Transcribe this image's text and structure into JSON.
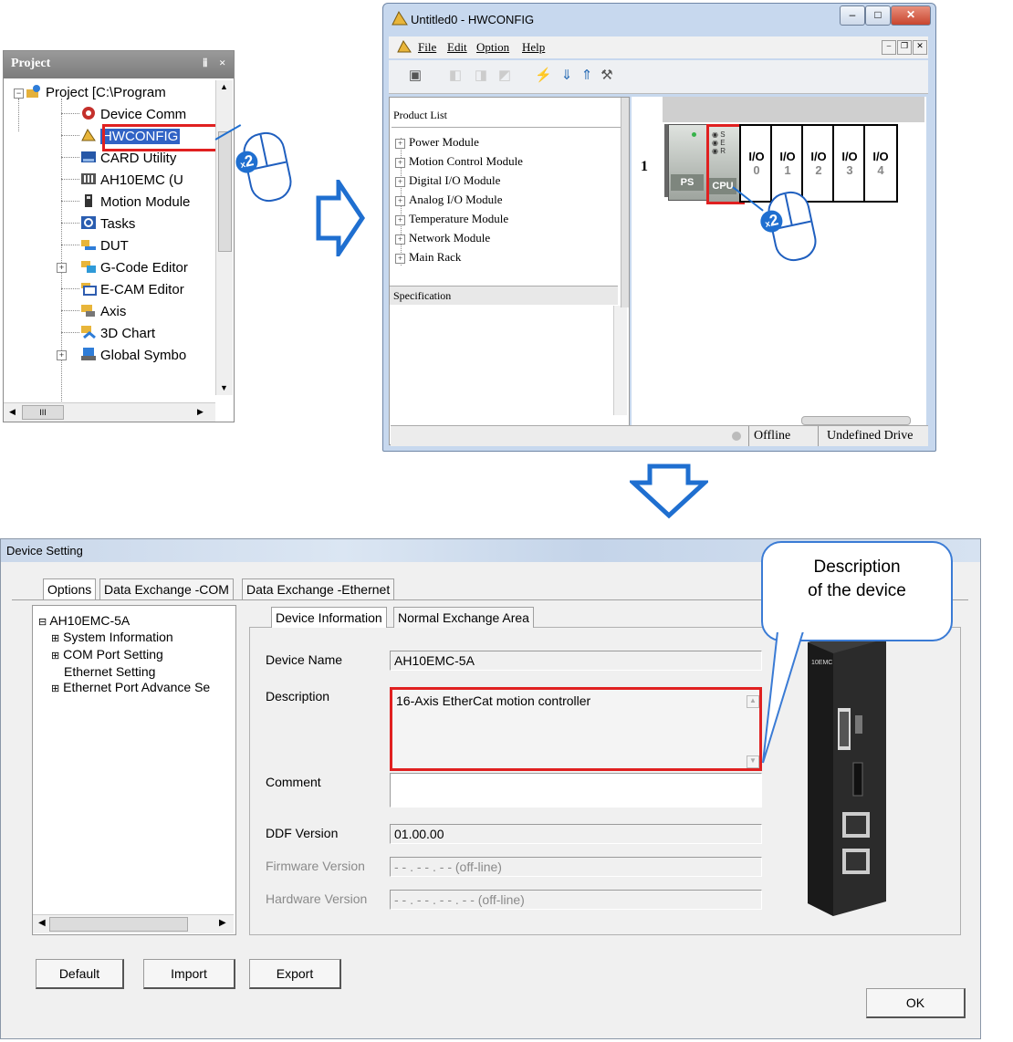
{
  "project_panel": {
    "title": "Project",
    "pin_glyph": "ⅱ",
    "close_glyph": "×",
    "items": [
      {
        "label": "Project [C:\\Program",
        "icon": "project-icon"
      },
      {
        "label": "Device Comm",
        "icon": "device-comm-icon"
      },
      {
        "label": "HWCONFIG",
        "icon": "hwconfig-icon"
      },
      {
        "label": "CARD Utility",
        "icon": "card-utility-icon"
      },
      {
        "label": "AH10EMC  (U",
        "icon": "plc-icon"
      },
      {
        "label": "Motion Module",
        "icon": "motion-module-icon"
      },
      {
        "label": "Tasks",
        "icon": "tasks-icon"
      },
      {
        "label": "DUT",
        "icon": "dut-icon"
      },
      {
        "label": "G-Code Editor",
        "icon": "gcode-editor-icon"
      },
      {
        "label": "E-CAM Editor",
        "icon": "ecam-editor-icon"
      },
      {
        "label": "Axis",
        "icon": "axis-icon"
      },
      {
        "label": "3D Chart",
        "icon": "chart-3d-icon"
      },
      {
        "label": "Global Symbo",
        "icon": "global-symbol-icon"
      }
    ],
    "scroll_h_glyph": "III"
  },
  "double_click_badge": "2",
  "double_click_prefix": "x",
  "hw_window": {
    "title": "Untitled0 - HWCONFIG",
    "menu": [
      "File",
      "Edit",
      "Option",
      "Help"
    ],
    "product_list_header": "Product List",
    "product_list": [
      "Power Module",
      "Motion Control Module",
      "Digital I/O Module",
      "Analog I/O Module",
      "Temperature Module",
      "Network Module",
      "Main Rack"
    ],
    "specification_header": "Specification",
    "rack_number": "1",
    "modules": {
      "ps_label": "PS",
      "cpu_label": "CPU",
      "cpu_leds": [
        "S",
        "E",
        "R"
      ],
      "io_label": "I/O",
      "io_slots": [
        "0",
        "1",
        "2",
        "3",
        "4"
      ]
    },
    "status_offline": "Offline",
    "status_drive": "Undefined Drive"
  },
  "device_dialog": {
    "title": "Device Setting",
    "tabs": [
      "Options",
      "Data Exchange -COM",
      "Data Exchange -Ethernet"
    ],
    "tree": {
      "root": "AH10EMC-5A",
      "children": [
        "System Information",
        "COM Port Setting",
        "Ethernet Setting",
        "Ethernet Port Advance Se"
      ]
    },
    "inner_tabs": [
      "Device Information",
      "Normal Exchange Area"
    ],
    "fields": {
      "device_name_label": "Device Name",
      "device_name_value": "AH10EMC-5A",
      "description_label": "Description",
      "description_value": "16-Axis EtherCat motion controller",
      "comment_label": "Comment",
      "comment_value": "",
      "ddf_label": "DDF Version",
      "ddf_value": "01.00.00",
      "firmware_label": "Firmware Version",
      "firmware_value": "- - . - - . - - (off-line)",
      "hardware_label": "Hardware Version",
      "hardware_value": "- - . - - . - - . - - (off-line)"
    },
    "buttons": {
      "default": "Default",
      "import": "Import",
      "export": "Export",
      "ok": "OK"
    },
    "device_brand": "10EMC"
  },
  "callout": {
    "line1": "Description",
    "line2": "of the device"
  },
  "colors": {
    "highlight_red": "#e02020",
    "arrow_blue": "#1f6fd0",
    "selection_blue": "#3163c5"
  }
}
